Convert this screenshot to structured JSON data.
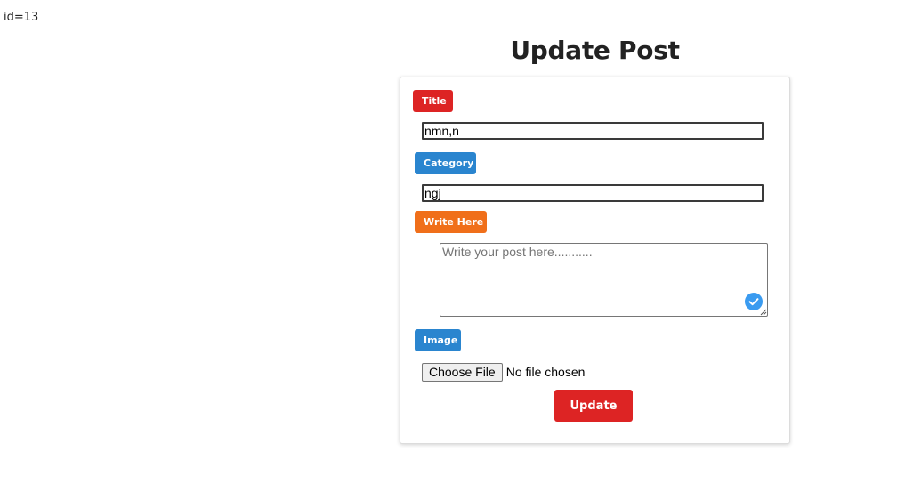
{
  "id_text": "id=13",
  "page_title": "Update Post",
  "colors": {
    "title_badge": "#dd2424",
    "category_badge": "#2a85cf",
    "write_badge": "#f06f1a",
    "image_badge": "#2a85cf",
    "update_button": "#dd2424",
    "check_icon": "#3a9bf0"
  },
  "form": {
    "title_label": "Title",
    "title_value": "nmn,n",
    "category_label": "Category",
    "category_value": "ngj",
    "write_label": "Write Here",
    "write_placeholder": "Write your post here...........",
    "image_label": "Image",
    "choose_file_label": "Choose File",
    "file_status": "No file chosen",
    "update_label": "Update"
  },
  "icons": {
    "check": "check-circle-icon",
    "resize": "resize-handle-icon"
  }
}
